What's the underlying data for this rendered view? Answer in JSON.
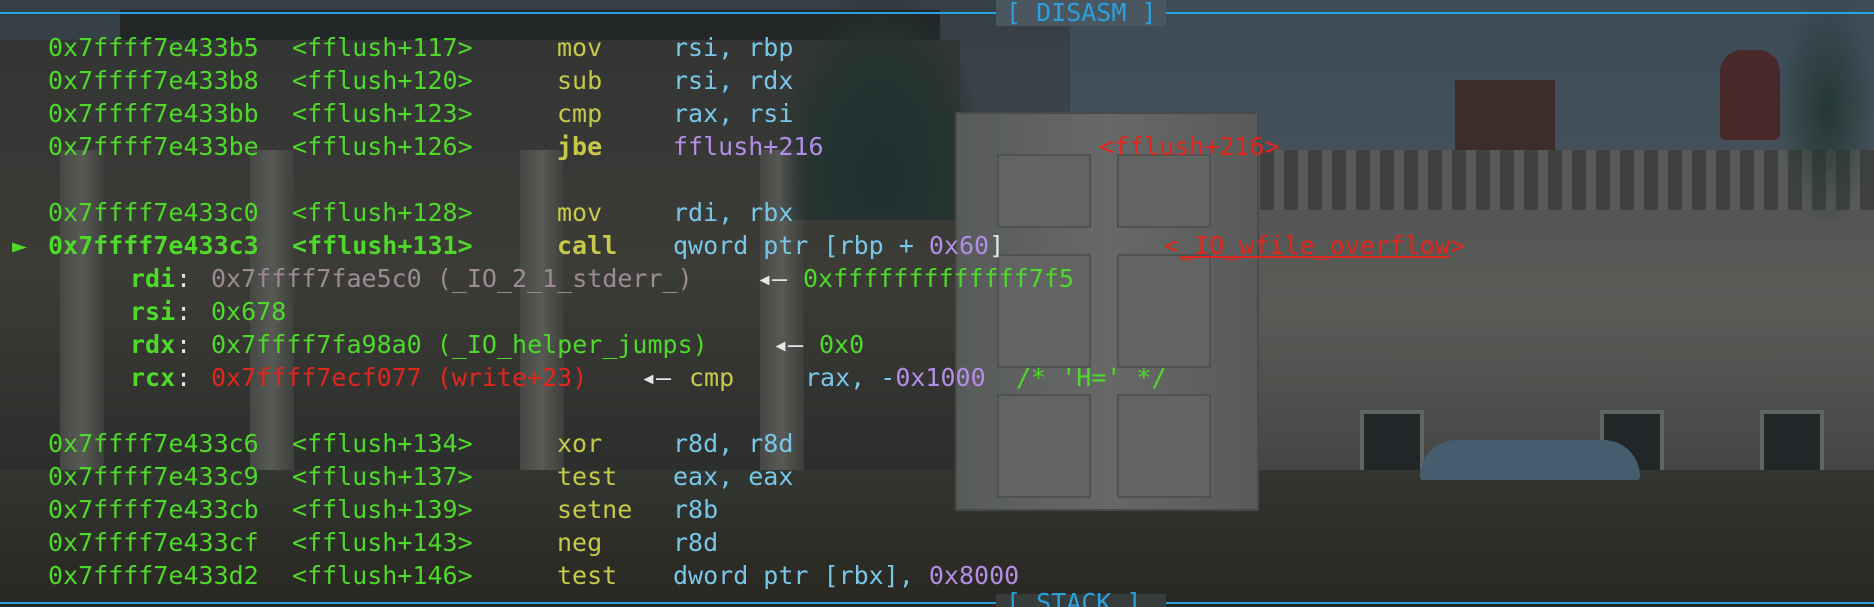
{
  "window": {
    "section_top": "[ DISASM ]",
    "section_bottom": "[ STACK ]",
    "rule_color": "#2aa1de"
  },
  "colors": {
    "address": "#4fd92b",
    "mnemonic": "#c7c94a",
    "operand": "#79c7e8",
    "number": "#b48ee6",
    "symbol_target": "#e1261d",
    "register_name": "#4fd92b",
    "pointer_grey": "#9c8a95"
  },
  "disasm": {
    "lines_before": [
      {
        "addr": "0x7ffff7e433b5",
        "sym": "<fflush+117>",
        "mnem": "mov",
        "ops_a": "rsi, rbp"
      },
      {
        "addr": "0x7ffff7e433b8",
        "sym": "<fflush+120>",
        "mnem": "sub",
        "ops_a": "rsi, rdx"
      },
      {
        "addr": "0x7ffff7e433bb",
        "sym": "<fflush+123>",
        "mnem": "cmp",
        "ops_a": "rax, rsi"
      },
      {
        "addr": "0x7ffff7e433be",
        "sym": "<fflush+126>",
        "mnem": "jbe",
        "ops_a": "fflush+216",
        "target": "<fflush+216>"
      }
    ],
    "lines_mid": [
      {
        "addr": "0x7ffff7e433c0",
        "sym": "<fflush+128>",
        "mnem": "mov",
        "ops_a": "rdi, rbx"
      }
    ],
    "current": {
      "marker": "►",
      "addr": "0x7ffff7e433c3",
      "sym": "<fflush+131>",
      "mnem": "call",
      "ops_pre": "qword ptr [rbp + ",
      "ops_num": "0x60",
      "ops_post": "]",
      "target_open": "<",
      "target_name": "_IO_wfile_overflow",
      "target_close": ">"
    },
    "args": {
      "rdi": {
        "name": "rdi",
        "colon": ":",
        "value": "0x7ffff7fae5c0 (_IO_2_1_stderr_)",
        "arrow": "◂—",
        "deref": "0xfffffffffffff7f5"
      },
      "rsi": {
        "name": "rsi",
        "colon": ":",
        "value": "0x678"
      },
      "rdx": {
        "name": "rdx",
        "colon": ":",
        "value": "0x7ffff7fa98a0 (_IO_helper_jumps)",
        "arrow": "◂—",
        "deref": "0x0"
      },
      "rcx": {
        "name": "rcx",
        "colon": ":",
        "value": "0x7ffff7ecf077 (write+23)",
        "arrow": "◂—",
        "deref_mnem": "cmp",
        "deref_ops": "rax, -",
        "deref_num": "0x1000",
        "deref_comment": "/* 'H=' */"
      }
    },
    "lines_after": [
      {
        "addr": "0x7ffff7e433c6",
        "sym": "<fflush+134>",
        "mnem": "xor",
        "ops_a": "r8d, r8d"
      },
      {
        "addr": "0x7ffff7e433c9",
        "sym": "<fflush+137>",
        "mnem": "test",
        "ops_a": "eax, eax"
      },
      {
        "addr": "0x7ffff7e433cb",
        "sym": "<fflush+139>",
        "mnem": "setne",
        "ops_a": "r8b"
      },
      {
        "addr": "0x7ffff7e433cf",
        "sym": "<fflush+143>",
        "mnem": "neg",
        "ops_a": "r8d"
      },
      {
        "addr": "0x7ffff7e433d2",
        "sym": "<fflush+146>",
        "mnem": "test",
        "ops_a": "dword ptr [rbx], ",
        "ops_num": "0x8000"
      }
    ]
  }
}
